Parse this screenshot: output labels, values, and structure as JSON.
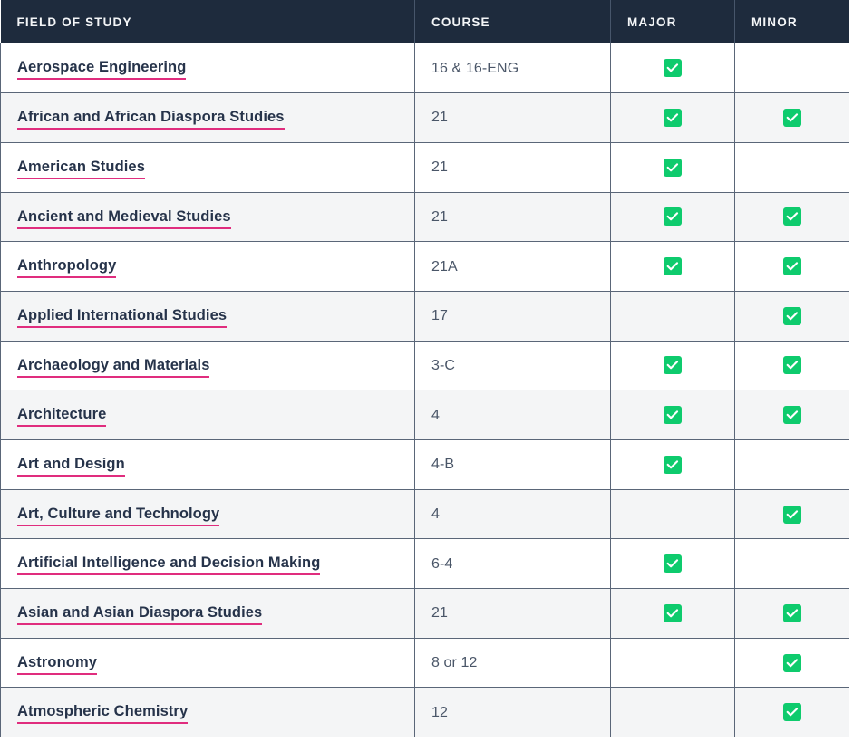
{
  "table": {
    "columns": [
      {
        "key": "field",
        "label": "FIELD OF STUDY"
      },
      {
        "key": "course",
        "label": "COURSE"
      },
      {
        "key": "major",
        "label": "MAJOR"
      },
      {
        "key": "minor",
        "label": "MINOR"
      }
    ],
    "rows": [
      {
        "field": "Aerospace Engineering",
        "course": "16 & 16-ENG",
        "major": true,
        "minor": false
      },
      {
        "field": "African and African Diaspora Studies",
        "course": "21",
        "major": true,
        "minor": true
      },
      {
        "field": "American Studies",
        "course": "21",
        "major": true,
        "minor": false
      },
      {
        "field": "Ancient and Medieval Studies",
        "course": "21",
        "major": true,
        "minor": true
      },
      {
        "field": "Anthropology",
        "course": "21A",
        "major": true,
        "minor": true
      },
      {
        "field": "Applied International Studies",
        "course": "17",
        "major": false,
        "minor": true
      },
      {
        "field": "Archaeology and Materials",
        "course": "3-C",
        "major": true,
        "minor": true
      },
      {
        "field": "Architecture",
        "course": "4",
        "major": true,
        "minor": true
      },
      {
        "field": "Art and Design",
        "course": "4-B",
        "major": true,
        "minor": false
      },
      {
        "field": "Art, Culture and Technology",
        "course": "4",
        "major": false,
        "minor": true
      },
      {
        "field": "Artificial Intelligence and Decision Making",
        "course": "6-4",
        "major": true,
        "minor": false
      },
      {
        "field": "Asian and Asian Diaspora Studies",
        "course": "21",
        "major": true,
        "minor": true
      },
      {
        "field": "Astronomy",
        "course": "8 or 12",
        "major": false,
        "minor": true
      },
      {
        "field": "Atmospheric Chemistry",
        "course": "12",
        "major": false,
        "minor": true
      }
    ]
  },
  "icons": {
    "checkmark": "checkmark-icon"
  },
  "colors": {
    "header_background": "#1e2b3d",
    "header_text": "#f4f6f8",
    "link_text": "#26334a",
    "link_underline": "#e02d7e",
    "check_green": "#0ecb6d",
    "row_alt_background": "#f4f5f6",
    "border": "#5a6678"
  }
}
